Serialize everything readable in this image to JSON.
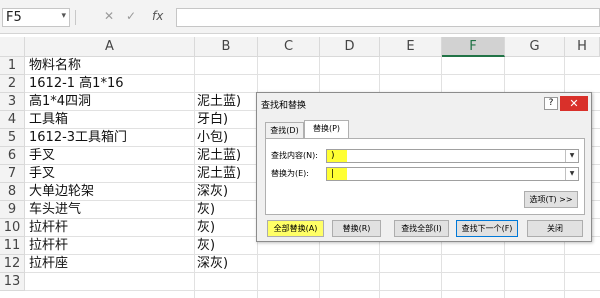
{
  "formula_bar": {
    "name_box": "F5",
    "cancel_icon": "✕",
    "enter_icon": "✓",
    "fx_label": "fx"
  },
  "columns": [
    "A",
    "B",
    "C",
    "D",
    "E",
    "F",
    "G",
    "H"
  ],
  "selected_column": "F",
  "rows": [
    {
      "num": "1",
      "a": "物料名称",
      "b": ""
    },
    {
      "num": "2",
      "a": "1612-1 高1*16",
      "b": ""
    },
    {
      "num": "3",
      "a": "高1*4四洞",
      "b": "泥土蓝)"
    },
    {
      "num": "4",
      "a": "工具箱",
      "b": "牙白)"
    },
    {
      "num": "5",
      "a": "1612-3工具箱门",
      "b": "小包)"
    },
    {
      "num": "6",
      "a": "手叉",
      "b": "泥土蓝)"
    },
    {
      "num": "7",
      "a": "手叉",
      "b": "泥土蓝)"
    },
    {
      "num": "8",
      "a": "大单边轮架",
      "b": "深灰)"
    },
    {
      "num": "9",
      "a": "车头进气",
      "b": "灰)"
    },
    {
      "num": "10",
      "a": "拉杆杆",
      "b": "灰)"
    },
    {
      "num": "11",
      "a": "拉杆杆",
      "b": "灰)"
    },
    {
      "num": "12",
      "a": "拉杆座",
      "b": "深灰)"
    },
    {
      "num": "13",
      "a": "",
      "b": ""
    }
  ],
  "dialog": {
    "title": "查找和替换",
    "help_label": "?",
    "close_label": "✕",
    "tab_find": "查找(D)",
    "tab_replace": "替换(P)",
    "find_label": "查找内容(N):",
    "find_value": ")",
    "replace_label": "替换为(E):",
    "replace_value": "|",
    "options_button": "选项(T) >>",
    "replace_all_button": "全部替换(A)",
    "replace_button": "替换(R)",
    "find_all_button": "查找全部(I)",
    "find_next_button": "查找下一个(F)",
    "close_button": "关闭"
  },
  "colors": {
    "highlight": "#ffff33",
    "selected_column_accent": "#217346",
    "close_red": "#d9302a"
  }
}
